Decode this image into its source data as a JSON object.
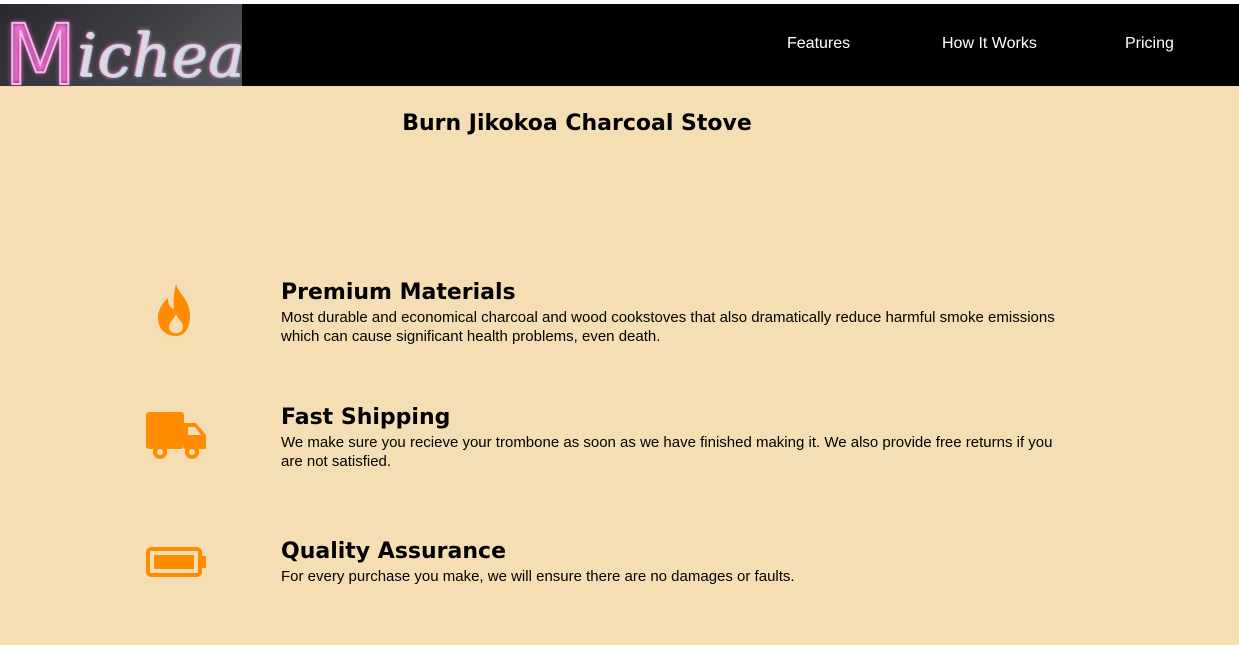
{
  "header": {
    "logo_text_first": "M",
    "logo_text_rest": "icheal",
    "nav": [
      {
        "label": "Features"
      },
      {
        "label": "How It Works"
      },
      {
        "label": "Pricing"
      }
    ]
  },
  "main": {
    "title": "Burn Jikokoa Charcoal Stove"
  },
  "features": [
    {
      "icon": "fire-icon",
      "heading": "Premium Materials",
      "text": "Most durable and economical charcoal and wood cookstoves that also dramatically reduce harmful smoke emissions which can cause significant health problems, even death."
    },
    {
      "icon": "truck-icon",
      "heading": "Fast Shipping",
      "text": "We make sure you recieve your trombone as soon as we have finished making it. We also provide free returns if you are not satisfied."
    },
    {
      "icon": "battery-icon",
      "heading": "Quality Assurance",
      "text": "For every purchase you make, we will ensure there are no damages or faults."
    }
  ],
  "colors": {
    "page_background": "#f5deb3",
    "header_background": "#000000",
    "icon_accent": "#ff8c00"
  }
}
